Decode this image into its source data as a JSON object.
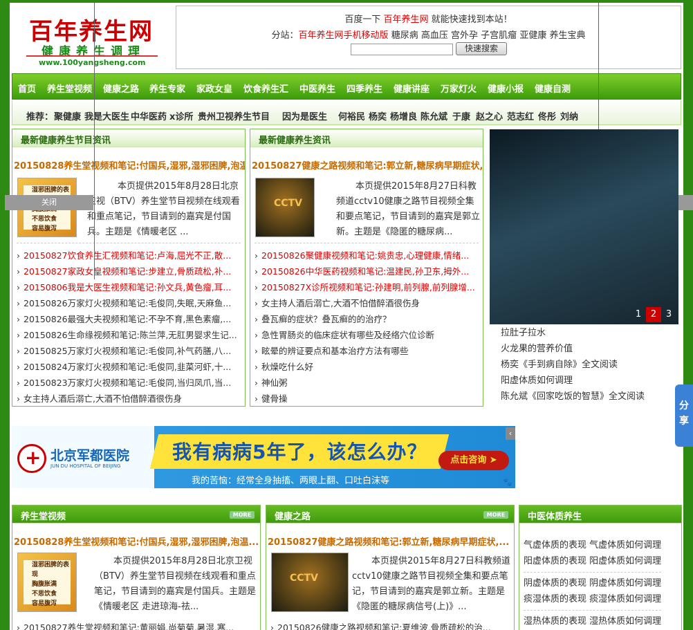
{
  "logo": {
    "main": "百年养生网",
    "sub": "健康养生调理",
    "url": "www.100yangsheng.com"
  },
  "header": {
    "line1_pre": "百度一下 ",
    "line1_red": "百年养生网",
    "line1_post": " 就能快速找到本站！",
    "substation_label": "分站：",
    "mobile_link": "百年养生网手机移动版",
    "sub_links": [
      "糖尿病",
      "高血压",
      "宫外孕",
      "子宫肌瘤",
      "亚健康",
      "养生宝典"
    ],
    "search_value": "",
    "search_button": "快速搜索"
  },
  "nav": [
    "首页",
    "养生堂视频",
    "健康之路",
    "养生专家",
    "家政女皇",
    "饮食养生汇",
    "中医养生",
    "四季养生",
    "健康讲座",
    "万家灯火",
    "健康小报",
    "健康自测"
  ],
  "recommend": {
    "label": "推荐：",
    "items": [
      "聚健康",
      "我是大医生",
      "中华医药",
      "x诊所",
      "贵州卫视养生节目",
      "因为是医生",
      "何裕民",
      "杨奕",
      "杨增良",
      "陈允斌",
      "于康",
      "赵之心",
      "范志红",
      "佟彤",
      "刘纳"
    ]
  },
  "box1": {
    "title": "最新健康养生节目资讯",
    "feature_title": "20150828养生堂视频和笔记:付国兵,湿邪,湿邪困脾,泡温...",
    "thumb_text": [
      "湿邪困脾的表现",
      "胸腹胀满",
      "不思饮食",
      "容易腹泻"
    ],
    "desc": "本页提供2015年8月28日北京卫视（BTV）养生堂节目视频在线观看和重点笔记，节目请到的嘉宾是付国兵。主题是《情暖老区 ...",
    "list": [
      {
        "t": "20150827饮食养生汇视频和笔记:卢海,屈光不正,散...",
        "red": true
      },
      {
        "t": "20150827家政女皇视频和笔记:步建立,骨质疏松,补...",
        "red": true
      },
      {
        "t": "20150806我是大医生视频和笔记:孙文兵,黄色瘤,耳...",
        "red": true
      },
      {
        "t": "20150826万家灯火视频和笔记:毛俊同,失眠,天麻鱼...",
        "red": false
      },
      {
        "t": "20150826最强大夫视频和笔记:不孕不育,黑色素瘤,...",
        "red": false
      },
      {
        "t": "20150826生命缘视频和笔记:陈兰萍,无肛男婴求生记...",
        "red": false
      },
      {
        "t": "20150825万家灯火视频和笔记:毛俊同,补气药膳,八...",
        "red": false
      },
      {
        "t": "20150824万家灯火视频和笔记:毛俊同,韭菜河虾,十...",
        "red": false
      },
      {
        "t": "20150823万家灯火视频和笔记:毛俊同,当归凤爪,当...",
        "red": false
      },
      {
        "t": "女主持人酒后溺亡,大酒不怕借醉酒很伤身",
        "red": false
      }
    ]
  },
  "box2": {
    "title": "最新健康养生资讯",
    "feature_title": "20150827健康之路视频和笔记:郭立新,糖尿病早期症状,...",
    "thumb_text": "CCTV",
    "desc": "本页提供2015年8月27日科教频道cctv10健康之路节目视频全集和要点笔记，节目请到的嘉宾是郭立新。主题是《隐匿的糖尿病...",
    "list": [
      {
        "t": "20150826聚健康视频和笔记:姚贵忠,心理健康,情绪...",
        "red": true
      },
      {
        "t": "20150826中华医药视频和笔记:温建民,孙卫东,拇外...",
        "red": true
      },
      {
        "t": "20150827X诊所视频和笔记:孙建明,前列腺,前列腺增...",
        "red": true
      },
      {
        "t": "女主持人酒后溺亡,大酒不怕借醉酒很伤身",
        "red": false
      },
      {
        "t": "叠瓦癣的症状？叠瓦癣的的治疗？",
        "red": false
      },
      {
        "t": "急性胃肠炎的临床症状有哪些及经络穴位诊断",
        "red": false
      },
      {
        "t": "眩晕的辨证要点和基本治疗方法有哪些",
        "red": false
      },
      {
        "t": "秋燥吃什么好",
        "red": false
      },
      {
        "t": "神仙粥",
        "red": false
      },
      {
        "t": "健骨操",
        "red": false
      }
    ]
  },
  "close_label": "关闭",
  "slider": {
    "pages": [
      "1",
      "2",
      "3"
    ],
    "active": 1
  },
  "right_list": [
    "拉肚子拉水",
    "火龙果的营养价值",
    "杨奕《手到病自除》全文阅读",
    "阳虚体质如何调理",
    "陈允斌《回家吃饭的智慧》全文阅读"
  ],
  "ad": {
    "hospital": "北京军都医院",
    "hospital_en": "JUN DU HOSPITAL OF BEIJING",
    "headline": "我有病病5年了，该怎么办？",
    "consult": "点击咨询 ➤",
    "sub": "我的苦恼：经常全身抽搐、两眼上翻、口吐白沫等"
  },
  "share_label": "分享",
  "bottom": {
    "box1": {
      "title": "养生堂视频",
      "more": "MORE",
      "feature_title": "20150828养生堂视频和笔记:付国兵,湿邪,湿邪困脾,泡温...",
      "desc": "本页提供2015年8月28日北京卫视（BTV）养生堂节目视频在线观看和重点笔记，节目请到的嘉宾是付国兵。主题是《情暖老区 走进琼海-祛...",
      "list_first": "20150827养生堂视频和笔记:黄丽娟,尚菊菊,暑湿,寒..."
    },
    "box2": {
      "title": "健康之路",
      "more": "MORE",
      "feature_title": "20150827健康之路视频和笔记:郭立新,糖尿病早期症状,...",
      "desc": "本页提供2015年8月27日科教频道cctv10健康之路节目视频全集和要点笔记，节目请到的嘉宾是郭立新。主题是《隐匿的糖尿病信号(上)》...",
      "list_first": "20150826健康之路视频和笔记:夏维波,骨质疏松的治..."
    },
    "box3": {
      "title": "中医体质养生",
      "lines": [
        [
          "气虚体质的表现",
          "气虚体质如何调理"
        ],
        [
          "阳虚体质的表现",
          "阳虚体质如何调理"
        ],
        [
          "阴虚体质的表现",
          "阴虚体质如何调理"
        ],
        [
          "痰湿体质的表现",
          "痰湿体质如何调理"
        ],
        [
          "湿热体质的表现",
          "湿热体质如何调理"
        ]
      ]
    }
  }
}
